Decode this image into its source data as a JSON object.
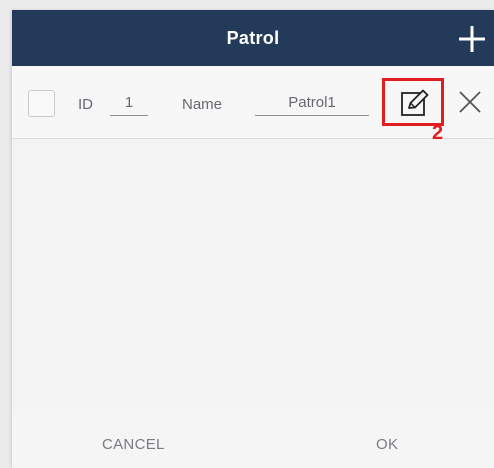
{
  "header": {
    "title": "Patrol",
    "add_icon": "plus-icon"
  },
  "row": {
    "id_label": "ID",
    "id_value": "1",
    "name_label": "Name",
    "name_value": "Patrol1",
    "edit_icon": "edit-icon",
    "close_icon": "close-icon"
  },
  "annotation": {
    "step": "2",
    "color": "#e11d20"
  },
  "footer": {
    "cancel_label": "CANCEL",
    "ok_label": "OK"
  },
  "colors": {
    "header_bg": "#243a5a",
    "accent": "#e11d20"
  }
}
